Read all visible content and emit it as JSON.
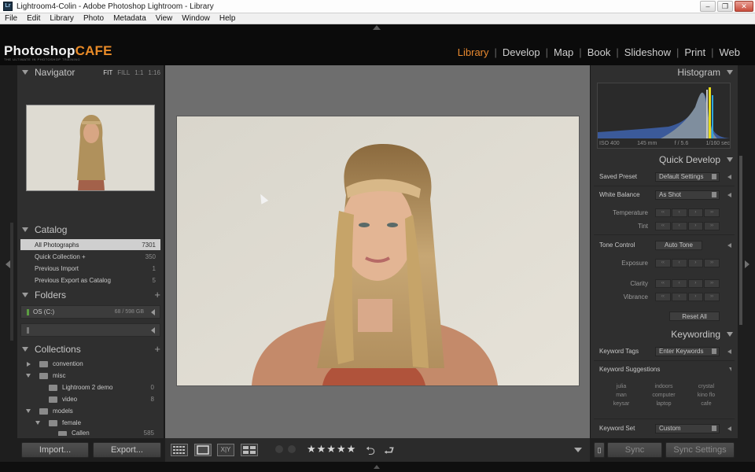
{
  "window": {
    "title": "Lightroom4-Colin - Adobe Photoshop Lightroom - Library",
    "app_icon": "Lr"
  },
  "menu": [
    "File",
    "Edit",
    "Library",
    "Photo",
    "Metadata",
    "View",
    "Window",
    "Help"
  ],
  "identity": {
    "logo_part1": "Photoshop",
    "logo_part2": "CAFE",
    "logo_sub": "THE ULTIMATE IN PHOTOSHOP TRAINING"
  },
  "modules": [
    "Library",
    "Develop",
    "Map",
    "Book",
    "Slideshow",
    "Print",
    "Web"
  ],
  "active_module": "Library",
  "accent_color": "#e9892f",
  "navigator": {
    "title": "Navigator",
    "options": [
      "FIT",
      "FILL",
      "1:1",
      "1:16"
    ]
  },
  "catalog": {
    "title": "Catalog",
    "items": [
      {
        "label": "All Photographs",
        "count": "7301",
        "selected": true
      },
      {
        "label": "Quick Collection +",
        "count": "350",
        "selected": false
      },
      {
        "label": "Previous Import",
        "count": "1",
        "selected": false
      },
      {
        "label": "Previous Export as Catalog",
        "count": "5",
        "selected": false
      }
    ]
  },
  "folders": {
    "title": "Folders",
    "items": [
      {
        "label": "OS (C:)",
        "size": "68 / 598 GB"
      },
      {
        "label": "",
        "size": ""
      }
    ]
  },
  "collections": {
    "title": "Collections",
    "items": [
      {
        "label": "convention",
        "count": "",
        "expanded": false
      },
      {
        "label": "misc",
        "count": "",
        "expanded": true
      },
      {
        "label": "Lightroom 2 demo",
        "count": "0",
        "expanded": null
      },
      {
        "label": "video",
        "count": "8",
        "expanded": null
      },
      {
        "label": "models",
        "count": "",
        "expanded": true
      },
      {
        "label": "female",
        "count": "",
        "expanded": true
      },
      {
        "label": "Callen",
        "count": "585",
        "expanded": null
      }
    ]
  },
  "buttons": {
    "import": "Import...",
    "export": "Export...",
    "sync": "Sync",
    "sync_settings": "Sync Settings"
  },
  "toolbar": {
    "rating": 4,
    "stars": "★★★★★"
  },
  "histogram": {
    "title": "Histogram",
    "iso": "ISO 400",
    "focal": "145 mm",
    "aperture": "f / 5.6",
    "shutter": "1/160 sec"
  },
  "quick_develop": {
    "title": "Quick Develop",
    "saved_preset_label": "Saved Preset",
    "saved_preset_value": "Default Settings",
    "white_balance_label": "White Balance",
    "white_balance_value": "As Shot",
    "temperature_label": "Temperature",
    "tint_label": "Tint",
    "tone_control_label": "Tone Control",
    "auto_tone": "Auto Tone",
    "exposure_label": "Exposure",
    "clarity_label": "Clarity",
    "vibrance_label": "Vibrance",
    "reset_all": "Reset All"
  },
  "keywording": {
    "title": "Keywording",
    "tags_label": "Keyword Tags",
    "tags_value": "Enter Keywords",
    "suggestions_label": "Keyword Suggestions",
    "suggestions": [
      "julia",
      "indoors",
      "crystal",
      "man",
      "computer",
      "kino flo",
      "keysar",
      "laptop",
      "cafe"
    ],
    "set_label": "Keyword Set",
    "set_value": "Custom"
  }
}
